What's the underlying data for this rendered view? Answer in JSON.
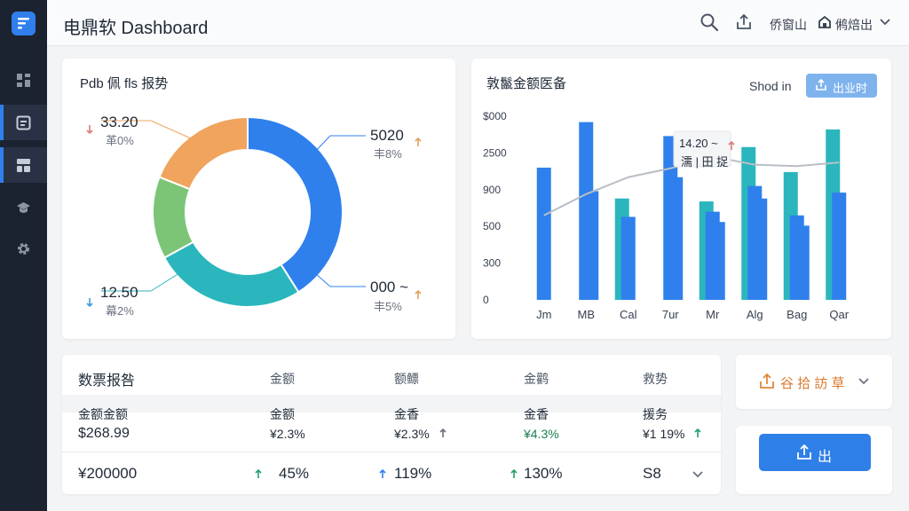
{
  "app": {
    "title": "电鼎软 Dashboard",
    "header_link": "侨窗山",
    "user_label": "鸺焙出"
  },
  "sidebar": {
    "items": [
      {
        "icon": "grid-icon",
        "active": false
      },
      {
        "icon": "document-icon",
        "active": true
      },
      {
        "icon": "layout-icon",
        "active": true
      },
      {
        "icon": "hat-icon",
        "active": false
      },
      {
        "icon": "gear-icon",
        "active": false
      }
    ]
  },
  "donut_card": {
    "title": "Pdb 佩 fls 报势",
    "labels": [
      {
        "value": "33.20",
        "pct": "革0%",
        "arrow": "down"
      },
      {
        "value": "5020",
        "pct": "丰8%",
        "arrow": "up"
      },
      {
        "value": "12.50",
        "pct": "幕2%",
        "arrow": "down"
      },
      {
        "value": "000 ~",
        "pct": "丰5%",
        "arrow": "up"
      }
    ]
  },
  "bar_card": {
    "title": "敦鬣金额医备",
    "filter_label": "Shod in",
    "export_label": "出业时",
    "tooltip_value": "14.20 ~",
    "tooltip_label": "濡 | 田 捉"
  },
  "table": {
    "title": "数票报咎",
    "columns": [
      "金额",
      "额鳔",
      "金鹳",
      "救势"
    ],
    "row1": [
      "金额金额",
      "金额",
      "金香",
      "金香",
      "援务"
    ],
    "row2": [
      "$268.99",
      "¥2.3%",
      "¥2.3%",
      "¥4.3%",
      "¥1 19% "
    ],
    "row3": [
      "¥200000",
      "45%",
      "119%",
      "130%",
      "S8"
    ]
  },
  "side_panel": {
    "dropdown_label": "谷 拾 訪 草",
    "action_label": "出"
  },
  "colors": {
    "accent": "#2f80ed",
    "donut": [
      "#2f80ed",
      "#2bb6bd",
      "#7cc576",
      "#f0a45d"
    ],
    "bar_blue": "#2f80ed",
    "bar_teal": "#2bb6bd",
    "up_green": "#22a06b"
  },
  "chart_data": [
    {
      "type": "pie",
      "donut": true,
      "title": "Pdb 佩 fls 报势",
      "slices": [
        {
          "value": 41,
          "color": "#2f80ed"
        },
        {
          "value": 26,
          "color": "#2bb6bd"
        },
        {
          "value": 14,
          "color": "#7cc576"
        },
        {
          "value": 19,
          "color": "#f0a45d"
        }
      ]
    },
    {
      "type": "bar",
      "title": "敦鬣金额医备",
      "categories": [
        "Jm",
        "MB",
        "Cal",
        "7ur",
        "Mr",
        "Alg",
        "Bag",
        "Qar"
      ],
      "y_ticks": [
        "$000",
        "2500",
        "900",
        "500",
        "300",
        "0"
      ],
      "ylim": [
        0,
        2500
      ],
      "series": [
        {
          "values": [
            0,
            0,
            1380,
            0,
            1340,
            2080,
            1740,
            2320
          ],
          "color": "#2bb6bd"
        },
        {
          "values": [
            1800,
            2420,
            1130,
            2230,
            1200,
            1550,
            1150,
            1460
          ],
          "color": "#2f80ed"
        },
        {
          "values": [
            0,
            1480,
            0,
            1670,
            1060,
            1380,
            1010,
            0
          ],
          "color": "#2f80ed"
        }
      ],
      "line": [
        1150,
        1440,
        1670,
        1790,
        1950,
        1840,
        1820,
        1870
      ]
    }
  ]
}
